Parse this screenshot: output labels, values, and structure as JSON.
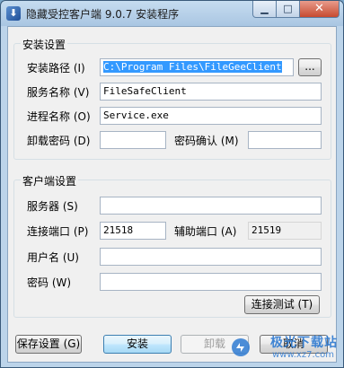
{
  "window": {
    "title": "隐藏受控客户端 9.0.7 安装程序",
    "icon": "installer-icon",
    "controls": {
      "minimize": "▁",
      "maximize": "□",
      "close": "✕"
    }
  },
  "install_settings": {
    "group_title": "安装设置",
    "path_label": "安装路径 (I)",
    "path_value": "C:\\Program Files\\FileGeeClient",
    "browse_label": "...",
    "service_label": "服务名称 (V)",
    "service_value": "FileSafeClient",
    "process_label": "进程名称 (O)",
    "process_value": "Service.exe",
    "uninstall_pw_label": "卸载密码 (D)",
    "uninstall_pw_value": "",
    "pw_confirm_label": "密码确认 (M)",
    "pw_confirm_value": ""
  },
  "client_settings": {
    "group_title": "客户端设置",
    "server_label": "服务器 (S)",
    "server_value": "",
    "conn_port_label": "连接端口 (P)",
    "conn_port_value": "21518",
    "aux_port_label": "辅助端口 (A)",
    "aux_port_value": "21519",
    "username_label": "用户名 (U)",
    "username_value": "",
    "password_label": "密码 (W)",
    "password_value": "",
    "test_conn_label": "连接测试 (T)"
  },
  "footer": {
    "save_label": "保存设置 (G)",
    "install_label": "安装",
    "uninstall_label": "卸载",
    "cancel_label": "取消"
  },
  "watermark": {
    "text": "极光下载站",
    "url": "www.xz7.com"
  }
}
